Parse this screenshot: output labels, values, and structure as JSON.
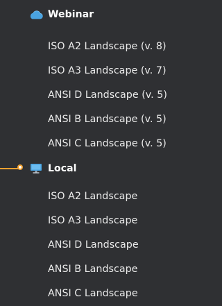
{
  "groups": {
    "webinar": {
      "label": "Webinar",
      "icon": "cloud-icon",
      "icon_color": "#4aa3e0",
      "items": [
        "ISO A2 Landscape (v. 8)",
        "ISO A3 Landscape (v. 7)",
        "ANSI D Landscape (v. 5)",
        "ANSI B Landscape (v. 5)",
        "ANSI C Landscape (v. 5)"
      ]
    },
    "local": {
      "label": "Local",
      "icon": "monitor-icon",
      "icon_color": "#4aa3e0",
      "items": [
        "ISO A2 Landscape",
        "ISO A3 Landscape",
        "ANSI D Landscape",
        "ANSI B Landscape",
        "ANSI C Landscape"
      ]
    }
  },
  "colors": {
    "background": "#2f3033",
    "text": "#eaeaea",
    "header_text": "#ffffff",
    "connector": "#f0a030"
  }
}
